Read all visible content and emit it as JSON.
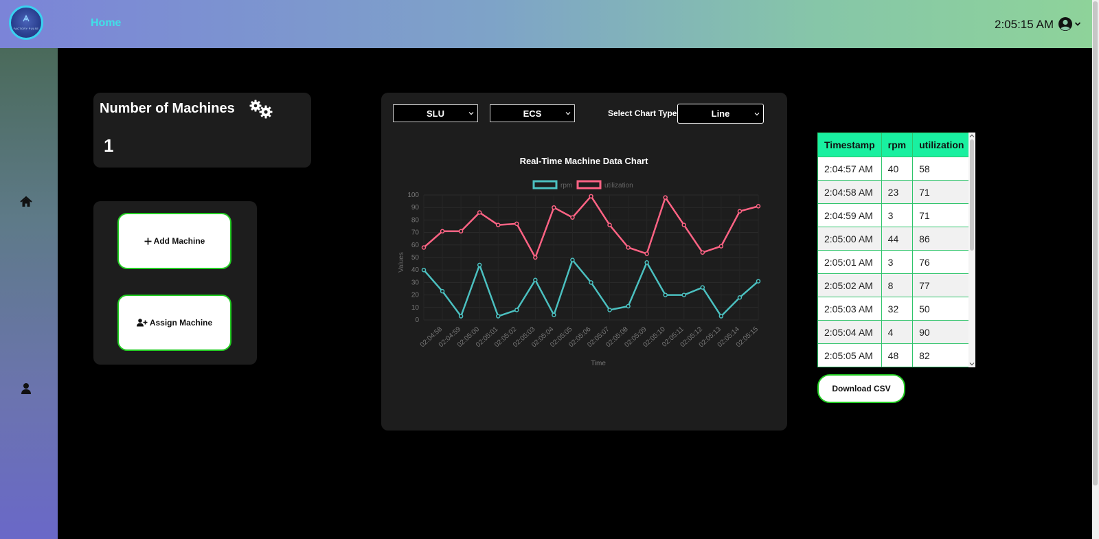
{
  "header": {
    "logo_text": "FACTORY PULSE",
    "home_label": "Home",
    "clock": "2:05:15 AM",
    "user_icon": "user-circle-icon"
  },
  "sidebar": {
    "items": [
      {
        "icon": "home-icon"
      },
      {
        "icon": "user-icon"
      }
    ]
  },
  "machines_card": {
    "title": "Number of Machines",
    "icon": "gears-icon",
    "count": "1"
  },
  "actions": {
    "add_machine": "Add Machine",
    "assign_machine": "Assign Machine"
  },
  "chart_controls": {
    "select1": "SLU",
    "select2": "ECS",
    "chart_type_label": "Select Chart Type",
    "chart_type_value": "Line"
  },
  "chart_data": {
    "type": "line",
    "title": "Real-Time Machine Data Chart",
    "xlabel": "Time",
    "ylabel": "Values",
    "ylim": [
      0,
      100
    ],
    "yticks": [
      0,
      10,
      20,
      30,
      40,
      50,
      60,
      70,
      80,
      90,
      100
    ],
    "x": [
      "02:04:57",
      "02:04:58",
      "02:04:59",
      "02:05:00",
      "02:05:01",
      "02:05:02",
      "02:05:03",
      "02:05:04",
      "02:05:05",
      "02:05:06",
      "02:05:07",
      "02:05:08",
      "02:05:09",
      "02:05:10",
      "02:05:11",
      "02:05:12",
      "02:05:13",
      "02:05:14",
      "02:05:15"
    ],
    "xtick_labels": [
      "02:04:58",
      "02:04:59",
      "02:05:00",
      "02:05:01",
      "02:05:02",
      "02:05:03",
      "02:05:04",
      "02:05:05",
      "02:05:06",
      "02:05:07",
      "02:05:08",
      "02:05:09",
      "02:05:10",
      "02:05:11",
      "02:05:12",
      "02:05:13",
      "02:05:14",
      "02:05:15"
    ],
    "grid": true,
    "legend_position": "top",
    "series": [
      {
        "name": "rpm",
        "color": "#4bc0c0",
        "values": [
          40,
          23,
          3,
          44,
          3,
          8,
          32,
          4,
          48,
          30,
          8,
          11,
          46,
          20,
          20,
          26,
          3,
          18,
          31
        ]
      },
      {
        "name": "utilization",
        "color": "#ff6384",
        "values": [
          58,
          71,
          71,
          86,
          76,
          77,
          50,
          90,
          82,
          99,
          76,
          58,
          53,
          98,
          76,
          54,
          59,
          87,
          91
        ]
      }
    ]
  },
  "data_table": {
    "columns": [
      "Timestamp",
      "rpm",
      "utilization"
    ],
    "rows": [
      [
        "2:04:57 AM",
        "40",
        "58"
      ],
      [
        "2:04:58 AM",
        "23",
        "71"
      ],
      [
        "2:04:59 AM",
        "3",
        "71"
      ],
      [
        "2:05:00 AM",
        "44",
        "86"
      ],
      [
        "2:05:01 AM",
        "3",
        "76"
      ],
      [
        "2:05:02 AM",
        "8",
        "77"
      ],
      [
        "2:05:03 AM",
        "32",
        "50"
      ],
      [
        "2:05:04 AM",
        "4",
        "90"
      ],
      [
        "2:05:05 AM",
        "48",
        "82"
      ]
    ]
  },
  "download_label": "Download CSV"
}
